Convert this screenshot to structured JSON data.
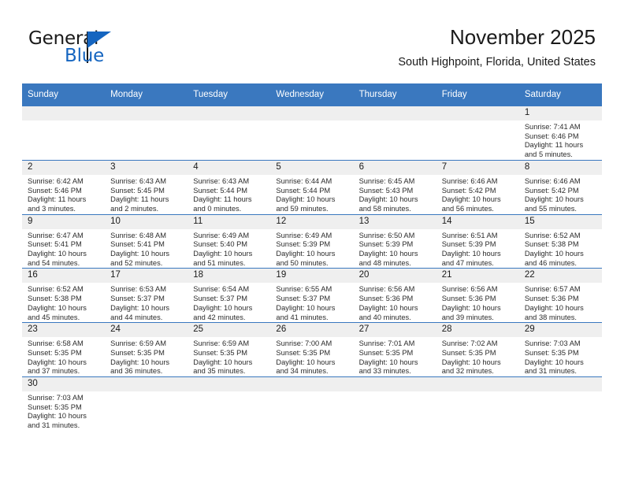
{
  "brand": {
    "name_top": "General",
    "name_bottom": "Blue",
    "color_primary": "#1565c0"
  },
  "header": {
    "title": "November 2025",
    "subtitle": "South Highpoint, Florida, United States"
  },
  "theme": {
    "header_row_bg": "#3a78bf",
    "daynum_bg": "#efefef",
    "grid_line": "#3a78bf"
  },
  "labels": {
    "sunrise_prefix": "Sunrise:",
    "sunset_prefix": "Sunset:",
    "daylight_prefix": "Daylight:"
  },
  "weekdays": [
    "Sunday",
    "Monday",
    "Tuesday",
    "Wednesday",
    "Thursday",
    "Friday",
    "Saturday"
  ],
  "weeks": [
    [
      {
        "day": "",
        "blank": true
      },
      {
        "day": "",
        "blank": true
      },
      {
        "day": "",
        "blank": true
      },
      {
        "day": "",
        "blank": true
      },
      {
        "day": "",
        "blank": true
      },
      {
        "day": "",
        "blank": true
      },
      {
        "day": "1",
        "sunrise": "Sunrise: 7:41 AM",
        "sunset": "Sunset: 6:46 PM",
        "daylight_line1": "Daylight: 11 hours",
        "daylight_line2": "and 5 minutes."
      }
    ],
    [
      {
        "day": "2",
        "sunrise": "Sunrise: 6:42 AM",
        "sunset": "Sunset: 5:46 PM",
        "daylight_line1": "Daylight: 11 hours",
        "daylight_line2": "and 3 minutes."
      },
      {
        "day": "3",
        "sunrise": "Sunrise: 6:43 AM",
        "sunset": "Sunset: 5:45 PM",
        "daylight_line1": "Daylight: 11 hours",
        "daylight_line2": "and 2 minutes."
      },
      {
        "day": "4",
        "sunrise": "Sunrise: 6:43 AM",
        "sunset": "Sunset: 5:44 PM",
        "daylight_line1": "Daylight: 11 hours",
        "daylight_line2": "and 0 minutes."
      },
      {
        "day": "5",
        "sunrise": "Sunrise: 6:44 AM",
        "sunset": "Sunset: 5:44 PM",
        "daylight_line1": "Daylight: 10 hours",
        "daylight_line2": "and 59 minutes."
      },
      {
        "day": "6",
        "sunrise": "Sunrise: 6:45 AM",
        "sunset": "Sunset: 5:43 PM",
        "daylight_line1": "Daylight: 10 hours",
        "daylight_line2": "and 58 minutes."
      },
      {
        "day": "7",
        "sunrise": "Sunrise: 6:46 AM",
        "sunset": "Sunset: 5:42 PM",
        "daylight_line1": "Daylight: 10 hours",
        "daylight_line2": "and 56 minutes."
      },
      {
        "day": "8",
        "sunrise": "Sunrise: 6:46 AM",
        "sunset": "Sunset: 5:42 PM",
        "daylight_line1": "Daylight: 10 hours",
        "daylight_line2": "and 55 minutes."
      }
    ],
    [
      {
        "day": "9",
        "sunrise": "Sunrise: 6:47 AM",
        "sunset": "Sunset: 5:41 PM",
        "daylight_line1": "Daylight: 10 hours",
        "daylight_line2": "and 54 minutes."
      },
      {
        "day": "10",
        "sunrise": "Sunrise: 6:48 AM",
        "sunset": "Sunset: 5:41 PM",
        "daylight_line1": "Daylight: 10 hours",
        "daylight_line2": "and 52 minutes."
      },
      {
        "day": "11",
        "sunrise": "Sunrise: 6:49 AM",
        "sunset": "Sunset: 5:40 PM",
        "daylight_line1": "Daylight: 10 hours",
        "daylight_line2": "and 51 minutes."
      },
      {
        "day": "12",
        "sunrise": "Sunrise: 6:49 AM",
        "sunset": "Sunset: 5:39 PM",
        "daylight_line1": "Daylight: 10 hours",
        "daylight_line2": "and 50 minutes."
      },
      {
        "day": "13",
        "sunrise": "Sunrise: 6:50 AM",
        "sunset": "Sunset: 5:39 PM",
        "daylight_line1": "Daylight: 10 hours",
        "daylight_line2": "and 48 minutes."
      },
      {
        "day": "14",
        "sunrise": "Sunrise: 6:51 AM",
        "sunset": "Sunset: 5:39 PM",
        "daylight_line1": "Daylight: 10 hours",
        "daylight_line2": "and 47 minutes."
      },
      {
        "day": "15",
        "sunrise": "Sunrise: 6:52 AM",
        "sunset": "Sunset: 5:38 PM",
        "daylight_line1": "Daylight: 10 hours",
        "daylight_line2": "and 46 minutes."
      }
    ],
    [
      {
        "day": "16",
        "sunrise": "Sunrise: 6:52 AM",
        "sunset": "Sunset: 5:38 PM",
        "daylight_line1": "Daylight: 10 hours",
        "daylight_line2": "and 45 minutes."
      },
      {
        "day": "17",
        "sunrise": "Sunrise: 6:53 AM",
        "sunset": "Sunset: 5:37 PM",
        "daylight_line1": "Daylight: 10 hours",
        "daylight_line2": "and 44 minutes."
      },
      {
        "day": "18",
        "sunrise": "Sunrise: 6:54 AM",
        "sunset": "Sunset: 5:37 PM",
        "daylight_line1": "Daylight: 10 hours",
        "daylight_line2": "and 42 minutes."
      },
      {
        "day": "19",
        "sunrise": "Sunrise: 6:55 AM",
        "sunset": "Sunset: 5:37 PM",
        "daylight_line1": "Daylight: 10 hours",
        "daylight_line2": "and 41 minutes."
      },
      {
        "day": "20",
        "sunrise": "Sunrise: 6:56 AM",
        "sunset": "Sunset: 5:36 PM",
        "daylight_line1": "Daylight: 10 hours",
        "daylight_line2": "and 40 minutes."
      },
      {
        "day": "21",
        "sunrise": "Sunrise: 6:56 AM",
        "sunset": "Sunset: 5:36 PM",
        "daylight_line1": "Daylight: 10 hours",
        "daylight_line2": "and 39 minutes."
      },
      {
        "day": "22",
        "sunrise": "Sunrise: 6:57 AM",
        "sunset": "Sunset: 5:36 PM",
        "daylight_line1": "Daylight: 10 hours",
        "daylight_line2": "and 38 minutes."
      }
    ],
    [
      {
        "day": "23",
        "sunrise": "Sunrise: 6:58 AM",
        "sunset": "Sunset: 5:35 PM",
        "daylight_line1": "Daylight: 10 hours",
        "daylight_line2": "and 37 minutes."
      },
      {
        "day": "24",
        "sunrise": "Sunrise: 6:59 AM",
        "sunset": "Sunset: 5:35 PM",
        "daylight_line1": "Daylight: 10 hours",
        "daylight_line2": "and 36 minutes."
      },
      {
        "day": "25",
        "sunrise": "Sunrise: 6:59 AM",
        "sunset": "Sunset: 5:35 PM",
        "daylight_line1": "Daylight: 10 hours",
        "daylight_line2": "and 35 minutes."
      },
      {
        "day": "26",
        "sunrise": "Sunrise: 7:00 AM",
        "sunset": "Sunset: 5:35 PM",
        "daylight_line1": "Daylight: 10 hours",
        "daylight_line2": "and 34 minutes."
      },
      {
        "day": "27",
        "sunrise": "Sunrise: 7:01 AM",
        "sunset": "Sunset: 5:35 PM",
        "daylight_line1": "Daylight: 10 hours",
        "daylight_line2": "and 33 minutes."
      },
      {
        "day": "28",
        "sunrise": "Sunrise: 7:02 AM",
        "sunset": "Sunset: 5:35 PM",
        "daylight_line1": "Daylight: 10 hours",
        "daylight_line2": "and 32 minutes."
      },
      {
        "day": "29",
        "sunrise": "Sunrise: 7:03 AM",
        "sunset": "Sunset: 5:35 PM",
        "daylight_line1": "Daylight: 10 hours",
        "daylight_line2": "and 31 minutes."
      }
    ],
    [
      {
        "day": "30",
        "sunrise": "Sunrise: 7:03 AM",
        "sunset": "Sunset: 5:35 PM",
        "daylight_line1": "Daylight: 10 hours",
        "daylight_line2": "and 31 minutes."
      },
      {
        "day": "",
        "blank": true
      },
      {
        "day": "",
        "blank": true
      },
      {
        "day": "",
        "blank": true
      },
      {
        "day": "",
        "blank": true
      },
      {
        "day": "",
        "blank": true
      },
      {
        "day": "",
        "blank": true
      }
    ]
  ]
}
